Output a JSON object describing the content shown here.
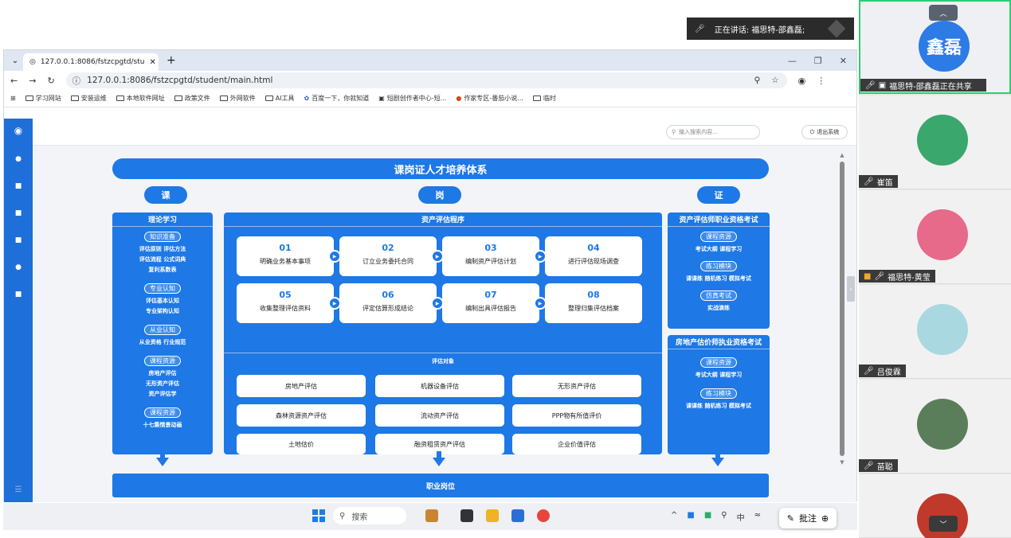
{
  "meeting": {
    "speaking_label": "正在讲话:",
    "speaking_name": "福思特-邵鑫磊;"
  },
  "browser": {
    "tab_title": "127.0.0.1:8086/fstzcpgtd/stu",
    "url": "127.0.0.1:8086/fstzcpgtd/student/main.html",
    "bookmarks": [
      "学习网站",
      "安装运维",
      "本地软件网址",
      "政策文件",
      "外网软件",
      "AI工具",
      "百度一下，你就知道",
      "短剧创作者中心-短...",
      "作家专区-番茄小说...",
      "临时"
    ]
  },
  "app": {
    "search_placeholder": "输入搜索内容...",
    "logout_label": "退出系统"
  },
  "diagram": {
    "title": "课岗证人才培养体系",
    "pills": [
      "课",
      "岗",
      "证"
    ],
    "left": {
      "title": "理论学习",
      "groups": [
        {
          "tag": "知识准备",
          "lines": [
            "评估原则  评估方法",
            "评估流程  公式词典",
            "复利系数表"
          ]
        },
        {
          "tag": "专业认知",
          "lines": [
            "评估基本认知",
            "专业架构认知"
          ]
        },
        {
          "tag": "从业认知",
          "lines": [
            "从业资格  行业规范"
          ]
        },
        {
          "tag": "课程资源",
          "lines": [
            "房地产评估",
            "无形资产评估",
            "资产评估学"
          ]
        },
        {
          "tag": "课程资源",
          "lines": [
            "十七集情景动画"
          ]
        }
      ]
    },
    "middle": {
      "title": "资产评估程序",
      "steps": [
        {
          "num": "01",
          "label": "明确业务基本事项"
        },
        {
          "num": "02",
          "label": "订立业务委托合同"
        },
        {
          "num": "03",
          "label": "编制资产评估计划"
        },
        {
          "num": "04",
          "label": "进行评估现场调查"
        },
        {
          "num": "05",
          "label": "收集整理评估资料"
        },
        {
          "num": "06",
          "label": "评定估算形成结论"
        },
        {
          "num": "07",
          "label": "编制出具评估报告"
        },
        {
          "num": "08",
          "label": "整理归集评估档案"
        }
      ],
      "objects_title": "评估对象",
      "objects": [
        "房地产评估",
        "机器设备评估",
        "无形资产评估",
        "森林资源资产评估",
        "流动资产评估",
        "PPP物有所值评价",
        "土地估价",
        "融资租赁资产评估",
        "企业价值评估"
      ]
    },
    "right": {
      "box1": {
        "title": "资产评估师职业资格考试",
        "groups": [
          {
            "tag": "课程资源",
            "lines": [
              "考试大纲  课程学习"
            ]
          },
          {
            "tag": "练习模块",
            "lines": [
              "课课练  随机练习  模拟考试"
            ]
          },
          {
            "tag": "仿真考试",
            "lines": [
              "实战演练"
            ]
          }
        ]
      },
      "box2": {
        "title": "房地产估价师执业资格考试",
        "groups": [
          {
            "tag": "课程资源",
            "lines": [
              "考试大纲  课程学习"
            ]
          },
          {
            "tag": "练习模块",
            "lines": [
              "课课练  随机练习  模拟考试"
            ]
          }
        ]
      }
    },
    "footer": "职业岗位"
  },
  "taskbar": {
    "search_label": "搜索",
    "tray_input": "中",
    "annotate_label": "批注"
  },
  "participants": {
    "presenter_avatar_text": "鑫磊",
    "sharing_label": "福思特-邵鑫磊正在共享",
    "names": [
      "崔笛",
      "福思特-黄莹",
      "吕俊霖",
      "苗聪"
    ]
  },
  "colors": {
    "brand_blue": "#1e78e6",
    "sidebar_blue": "#1e6fd9"
  }
}
